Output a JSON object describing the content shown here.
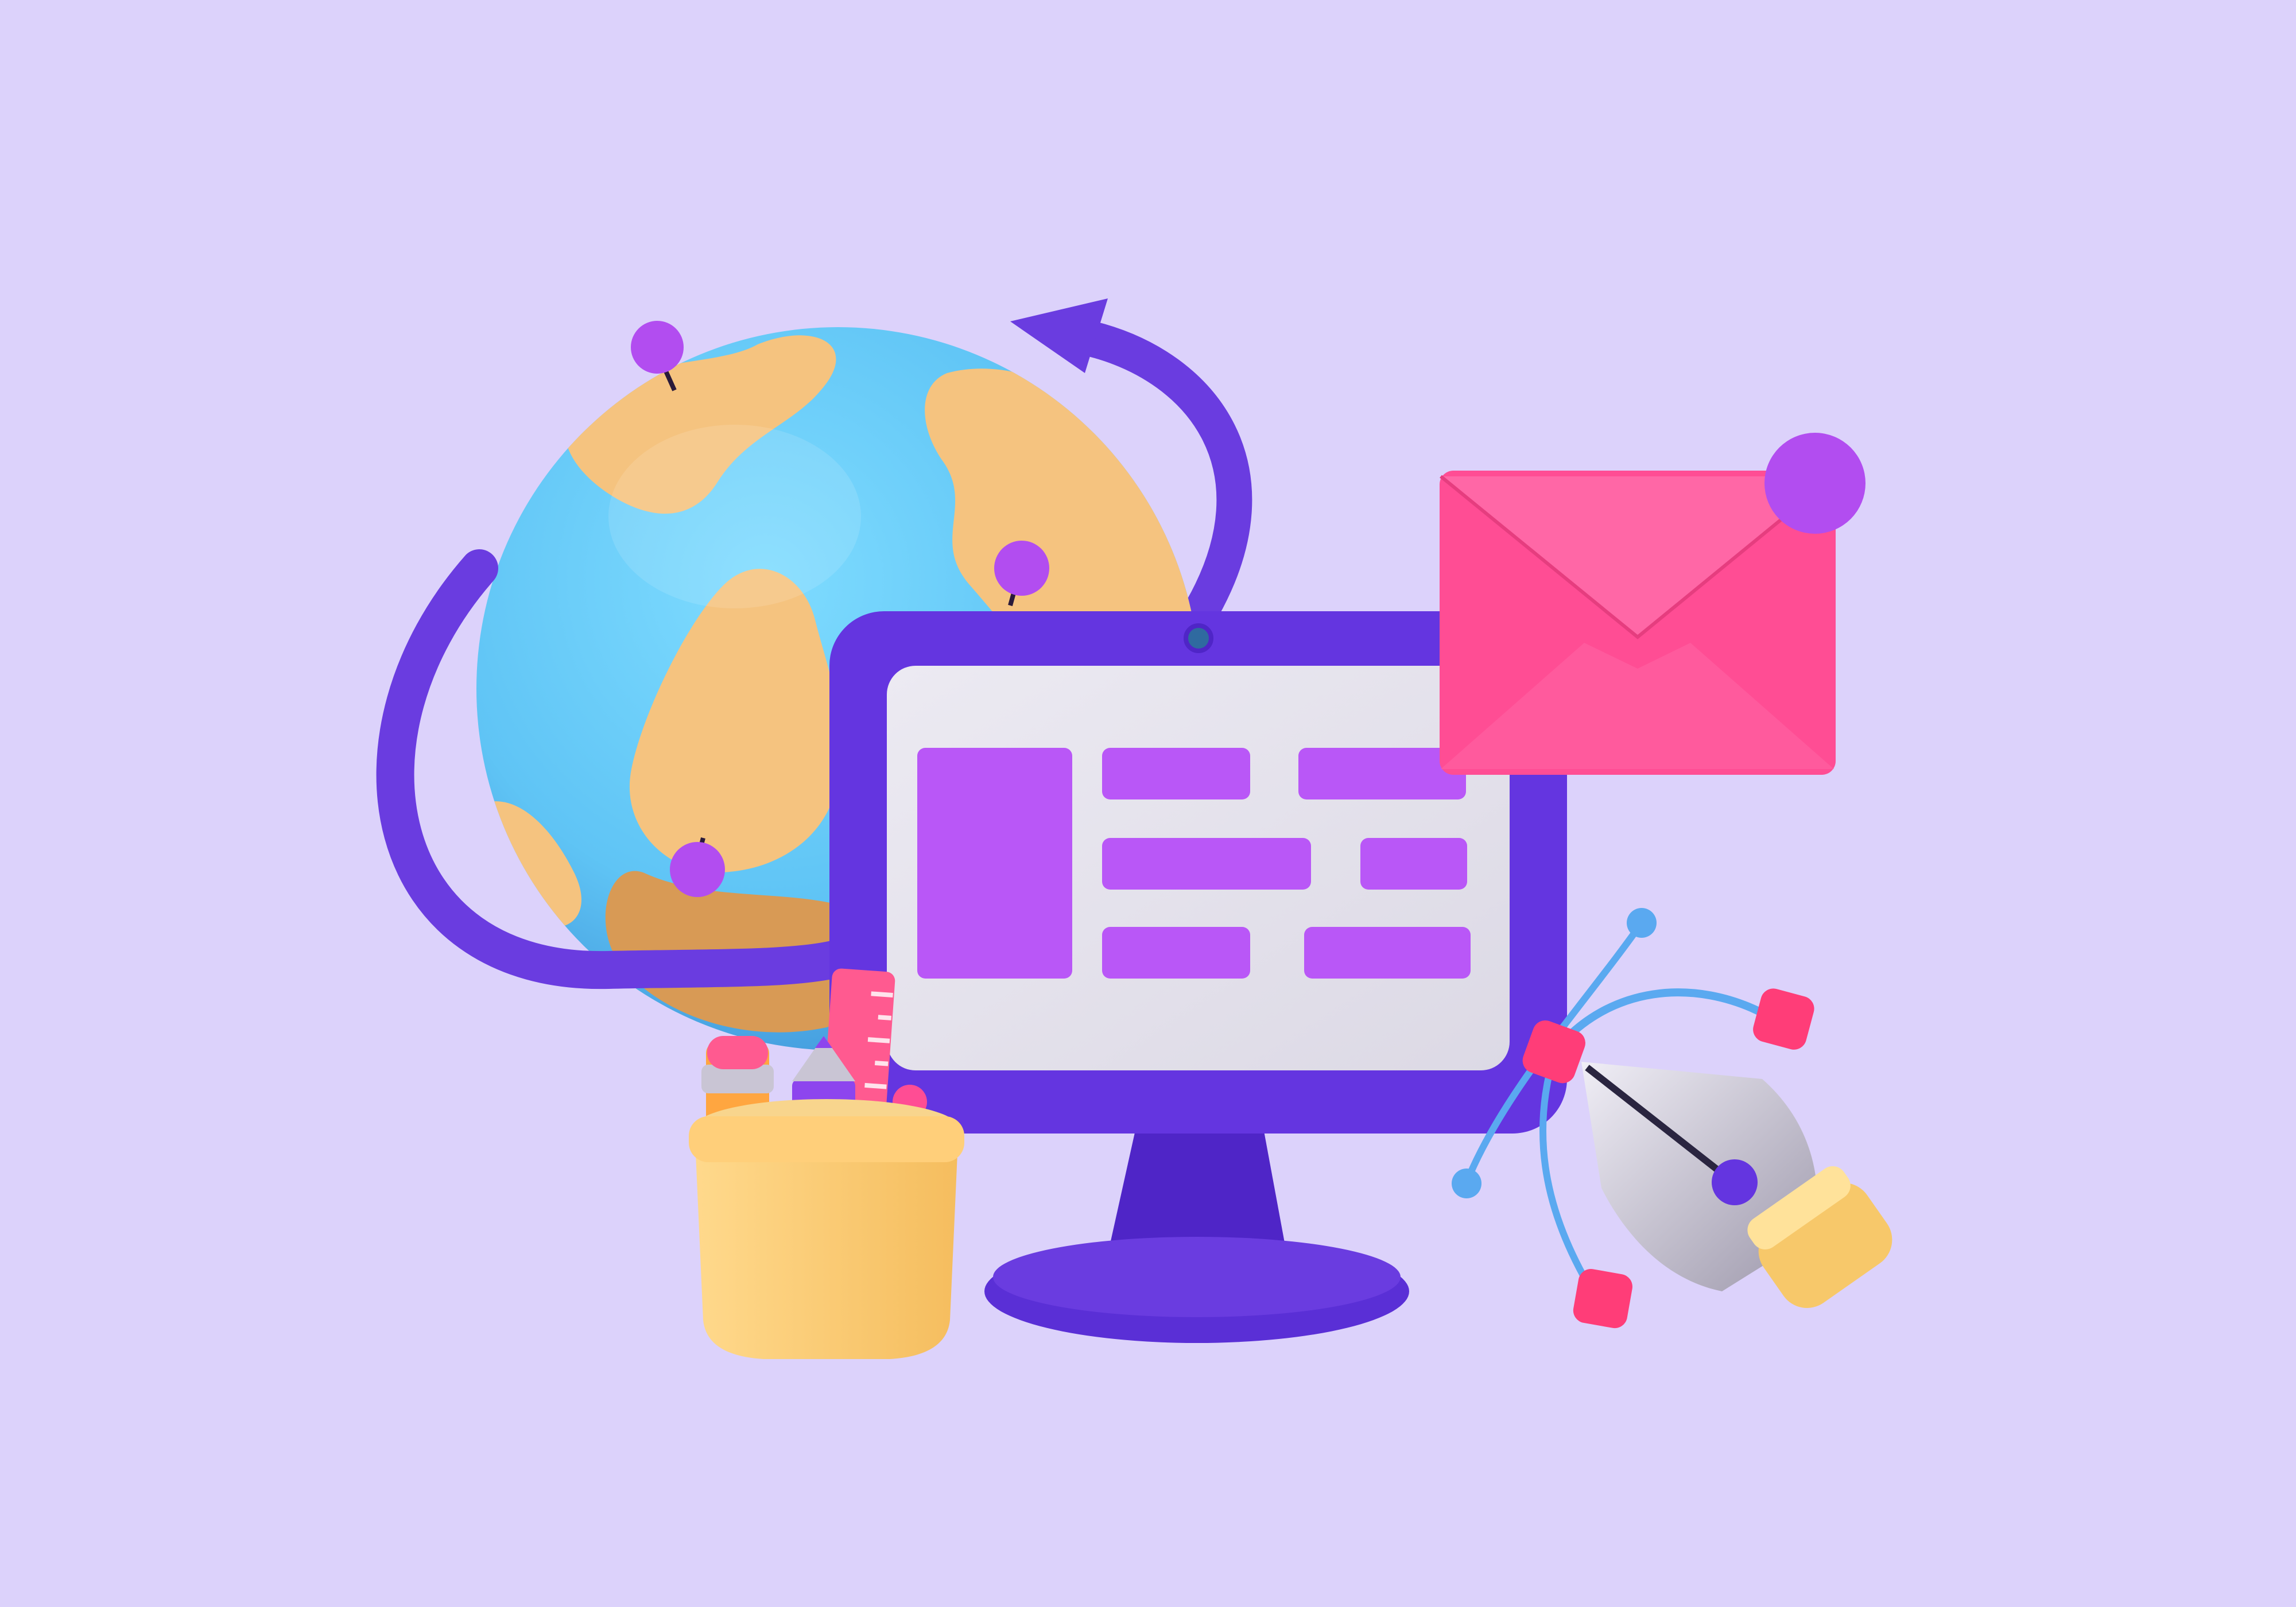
{
  "scene": {
    "background": "#dcd2fb",
    "elements": [
      {
        "name": "globe-icon",
        "colors": {
          "ocean": "#5fc4f5",
          "land": "#f5c37f",
          "land_shadow": "#d89a55"
        }
      },
      {
        "name": "orbit-arrow-icon",
        "color": "#6a3ce0"
      },
      {
        "name": "location-pin-icon",
        "count": 4,
        "color": "#b24df0"
      },
      {
        "name": "monitor-icon",
        "colors": {
          "frame": "#6435e0",
          "screen": "#e6e3ee",
          "blocks": "#b957f7"
        }
      },
      {
        "name": "webcam-icon"
      },
      {
        "name": "envelope-icon",
        "colors": {
          "paper": "#ff4d94",
          "flap": "#ff67a6",
          "badge": "#b24df0"
        }
      },
      {
        "name": "notification-badge-icon"
      },
      {
        "name": "pen-tool-icon",
        "colors": {
          "nib": "#c9c5d4",
          "ring": "#f7c86a",
          "curve": "#5aa9f0",
          "nodes": "#ff3d78"
        }
      },
      {
        "name": "bezier-curve-icon"
      },
      {
        "name": "pencil-cup-icon",
        "colors": {
          "cup": "#ffcf7a",
          "pencil": "#ffa640",
          "crayon": "#8d45ee",
          "ruler": "#ff5a90"
        }
      },
      {
        "name": "pencil-icon"
      },
      {
        "name": "ruler-icon"
      }
    ]
  }
}
